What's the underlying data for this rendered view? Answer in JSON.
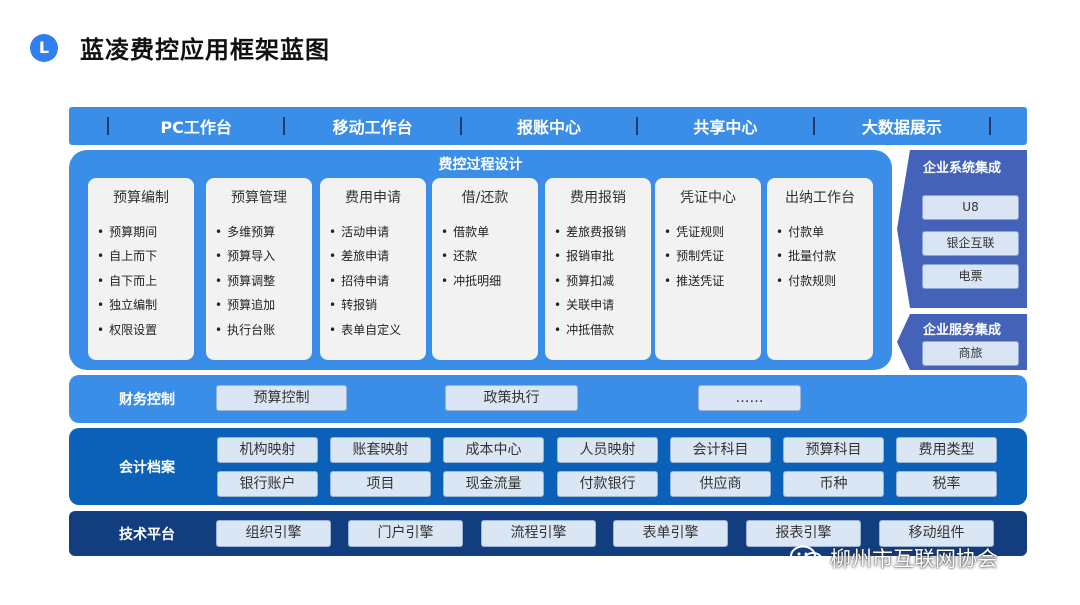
{
  "page": {
    "logo_letter": "L",
    "title": "蓝凌费控应用框架蓝图"
  },
  "top_bar": {
    "items": [
      "PC工作台",
      "移动工作台",
      "报账中心",
      "共享中心",
      "大数据展示"
    ]
  },
  "process": {
    "title": "费控过程设计",
    "cards": [
      {
        "title": "预算编制",
        "items": [
          "预算期间",
          "自上而下",
          "自下而上",
          "独立编制",
          "权限设置"
        ]
      },
      {
        "title": "预算管理",
        "items": [
          "多维预算",
          "预算导入",
          "预算调整",
          "预算追加",
          "执行台账"
        ]
      },
      {
        "title": "费用申请",
        "items": [
          "活动申请",
          "差旅申请",
          "招待申请",
          "转报销",
          "表单自定义"
        ]
      },
      {
        "title": "借/还款",
        "items": [
          "借款单",
          "还款",
          "冲抵明细"
        ]
      },
      {
        "title": "费用报销",
        "items": [
          "差旅费报销",
          "报销审批",
          "预算扣减",
          "关联申请",
          "冲抵借款"
        ]
      },
      {
        "title": "凭证中心",
        "items": [
          "凭证规则",
          "预制凭证",
          "推送凭证"
        ]
      },
      {
        "title": "出纳工作台",
        "items": [
          "付款单",
          "批量付款",
          "付款规则"
        ]
      }
    ]
  },
  "enterprise_system_integration": {
    "title": "企业系统集成",
    "items": [
      "U8",
      "银企互联",
      "电票"
    ]
  },
  "enterprise_service_integration": {
    "title": "企业服务集成",
    "items": [
      "商旅"
    ]
  },
  "finance_control": {
    "label": "财务控制",
    "items": [
      "预算控制",
      "政策执行",
      "……"
    ]
  },
  "accounting_archive": {
    "label": "会计档案",
    "row1": [
      "机构映射",
      "账套映射",
      "成本中心",
      "人员映射",
      "会计科目",
      "预算科目",
      "费用类型"
    ],
    "row2": [
      "银行账户",
      "项目",
      "现金流量",
      "付款银行",
      "供应商",
      "币种",
      "税率"
    ]
  },
  "tech_platform": {
    "label": "技术平台",
    "items": [
      "组织引擎",
      "门户引擎",
      "流程引擎",
      "表单引擎",
      "报表引擎",
      "移动组件"
    ]
  },
  "watermark": {
    "text": "柳州市互联网协会"
  }
}
